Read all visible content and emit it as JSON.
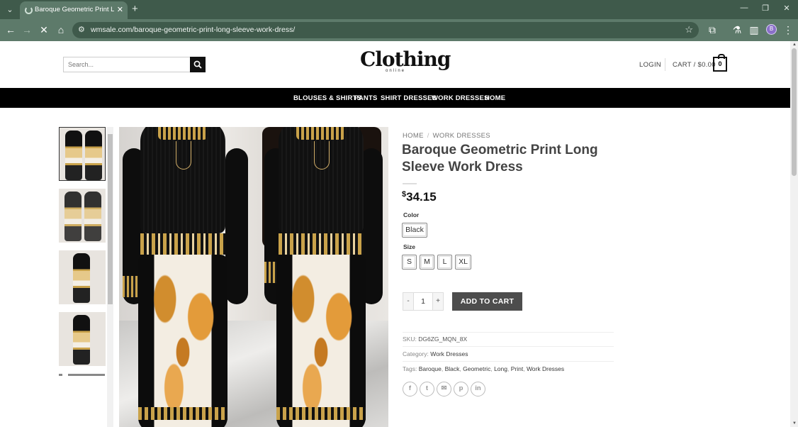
{
  "browser": {
    "tab_title": "Baroque Geometric Print Long Sleeve Work Dress",
    "url": "wmsale.com/baroque-geometric-print-long-sleeve-work-dress/",
    "avatar_initial": "B"
  },
  "header": {
    "search_placeholder": "Search...",
    "logo_main": "Clothing",
    "logo_sub": "online",
    "login": "LOGIN",
    "cart_label": "CART / $0.00",
    "cart_count": "0"
  },
  "nav": {
    "items": [
      "BLOUSES & SHIRTS",
      "PANTS",
      "SHIRT DRESSES",
      "WORK DRESSES",
      "HOME"
    ]
  },
  "product": {
    "breadcrumb": [
      "HOME",
      "WORK DRESSES"
    ],
    "breadcrumb_sep": "/",
    "title": "Baroque Geometric Print Long Sleeve Work Dress",
    "price_currency": "$",
    "price": "34.15",
    "color_label": "Color",
    "colors": [
      "Black"
    ],
    "size_label": "Size",
    "sizes": [
      "S",
      "M",
      "L",
      "XL"
    ],
    "qty_minus": "-",
    "qty": "1",
    "qty_plus": "+",
    "add_to_cart": "ADD TO CART",
    "sku_label": "SKU:",
    "sku": "DG6ZG_MQN_8X",
    "category_label": "Category:",
    "category": "Work Dresses",
    "tags_label": "Tags:",
    "tags": [
      "Baroque",
      "Black",
      "Geometric",
      "Long",
      "Print",
      "Work Dresses"
    ]
  },
  "share_icons": [
    "facebook-icon",
    "twitter-icon",
    "email-icon",
    "pinterest-icon",
    "linkedin-icon"
  ],
  "colors": {
    "nav_bg": "#000000",
    "add_to_cart_bg": "#4d4d4d",
    "chrome_bg": "#5d7a6a"
  }
}
